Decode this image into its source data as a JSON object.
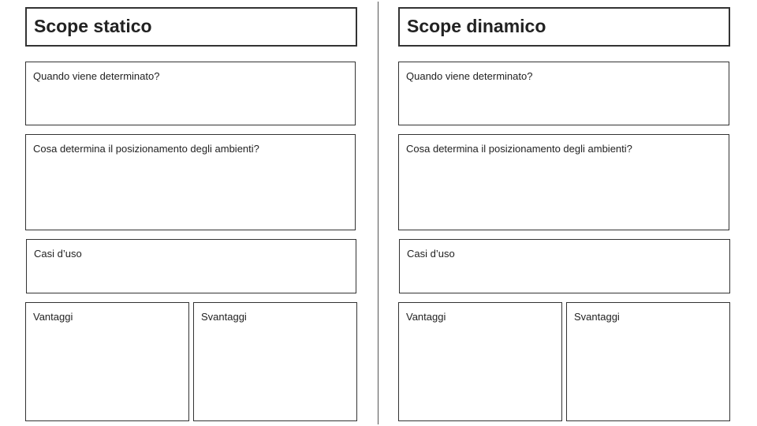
{
  "left": {
    "title": "Scope statico",
    "when": "Quando viene determinato?",
    "positioning": "Cosa determina il posizionamento degli ambienti?",
    "use_cases": "Casi d’uso",
    "advantages": "Vantaggi",
    "disadvantages": "Svantaggi"
  },
  "right": {
    "title": "Scope dinamico",
    "when": "Quando viene determinato?",
    "positioning": "Cosa determina il posizionamento degli ambienti?",
    "use_cases": "Casi d’uso",
    "advantages": "Vantaggi",
    "disadvantages": "Svantaggi"
  }
}
